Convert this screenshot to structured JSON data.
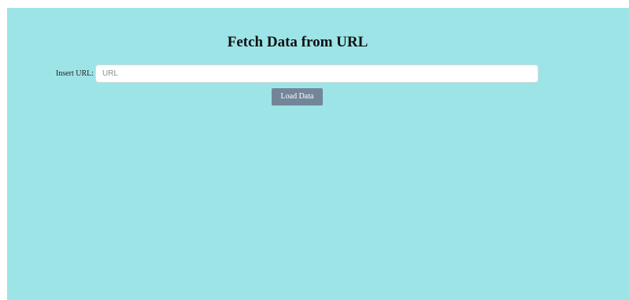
{
  "header": {
    "title": "Fetch Data from URL"
  },
  "form": {
    "url_label": "Insert URL:",
    "url_placeholder": "URL",
    "url_value": "",
    "load_button_label": "Load Data"
  },
  "colors": {
    "background": "#9de4e7",
    "button": "#738699",
    "button_text": "#ffffff",
    "input_background": "#ffffff"
  }
}
